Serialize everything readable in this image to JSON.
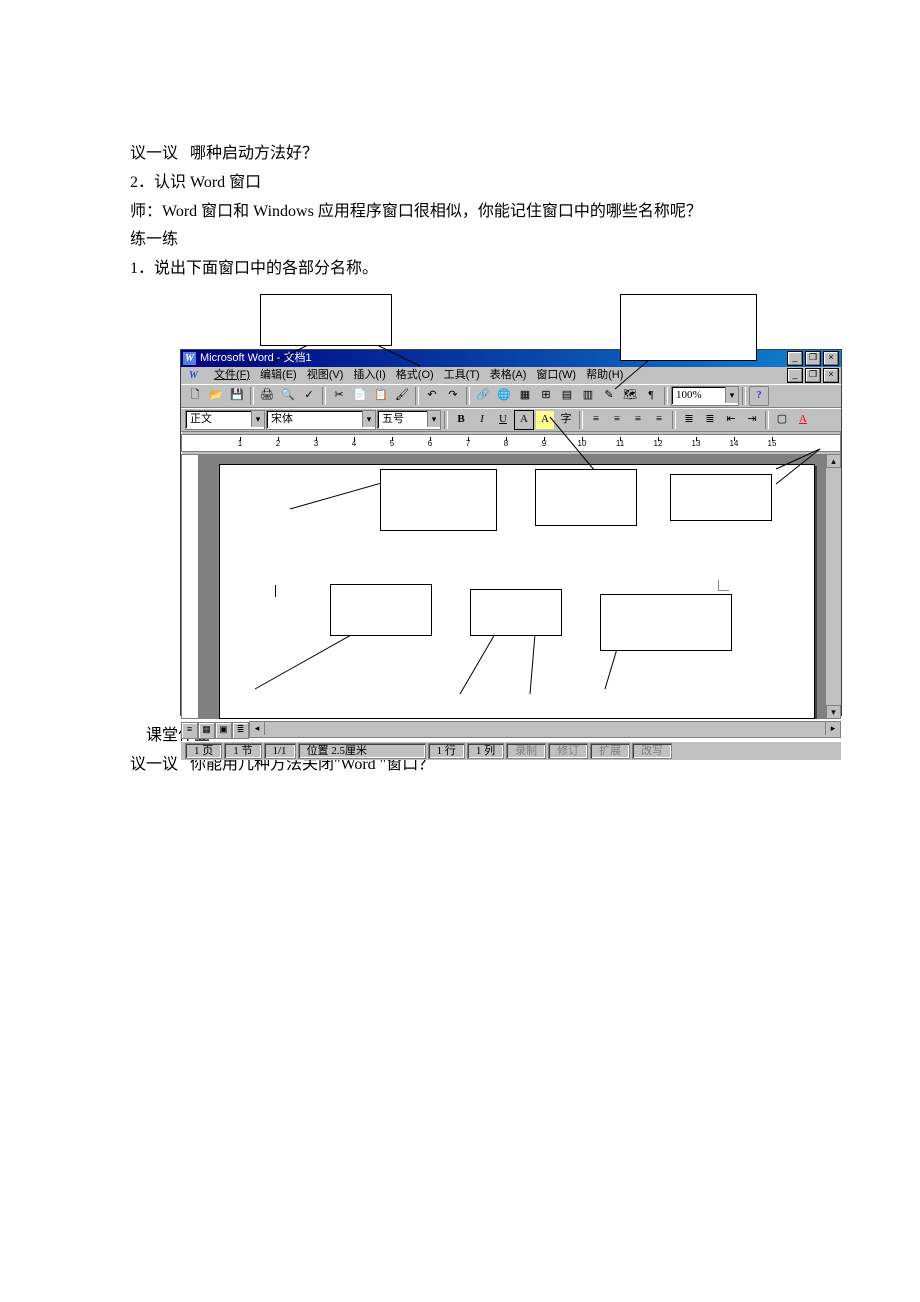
{
  "doc": {
    "l1": "议一议   哪种启动方法好？",
    "l2": "2．认识 Word 窗口",
    "l3": "师：Word 窗口和 Windows 应用程序窗口很相似，你能记住窗口中的哪些名称呢？",
    "l4": "练一练",
    "l5": "1．说出下面窗口中的各部分名称。",
    "l6": "    课堂作业",
    "l7": "议一议   你能用几种方法关闭\"Word \"窗口？"
  },
  "app": {
    "title": "Microsoft Word - 文档1",
    "icon_letter": "W",
    "menus": [
      "文件(F)",
      "编辑(E)",
      "视图(V)",
      "插入(I)",
      "格式(O)",
      "工具(T)",
      "表格(A)",
      "窗口(W)",
      "帮助(H)"
    ],
    "style_combo": "正文",
    "font_combo": "宋体",
    "size_combo": "五号",
    "zoom": "100%",
    "status": {
      "page": "1 页",
      "sec": "1 节",
      "pages": "1/1",
      "pos": "位置 2.5厘米",
      "line": "1 行",
      "col": "1 列",
      "rec": "录制",
      "trk": "修订",
      "ext": "扩展",
      "ovr": "改写"
    }
  },
  "icons": {
    "new": "🗋",
    "open": "📂",
    "save": "💾",
    "print": "🖨",
    "preview": "🔍",
    "spell": "✓",
    "cut": "✂",
    "copy": "📄",
    "paste": "📋",
    "fmt": "🖌",
    "undo": "↶",
    "redo": "↷",
    "link": "🔗",
    "web": "🌐",
    "tables": "▦",
    "table": "⊞",
    "excel": "▤",
    "cols": "▥",
    "draw": "✎",
    "map": "🗺",
    "para": "¶",
    "help": "?",
    "bold": "B",
    "italic": "I",
    "under": "U",
    "box": "A",
    "hi": "A",
    "char": "字",
    "left": "≡",
    "center": "≡",
    "right": "≡",
    "just": "≡",
    "numlist": "≣",
    "bullist": "≣",
    "outdent": "⇤",
    "indent": "⇥",
    "border": "▢",
    "color": "A"
  }
}
